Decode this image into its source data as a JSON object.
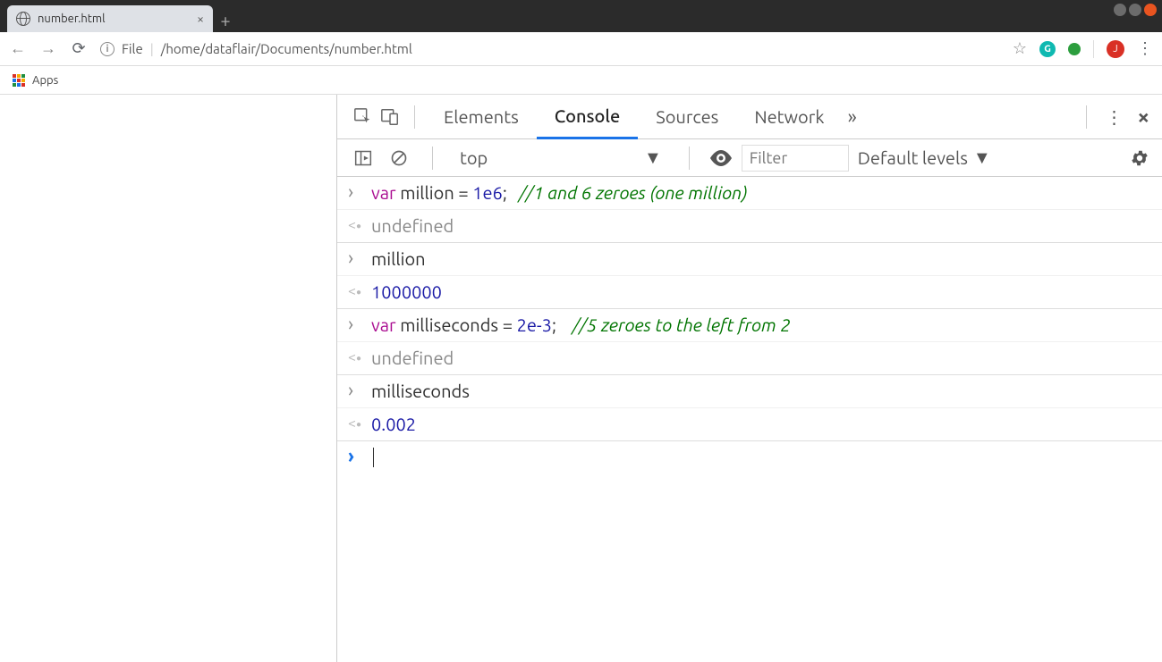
{
  "tab": {
    "title": "number.html"
  },
  "addressbar": {
    "file_label": "File",
    "path": "/home/dataflair/Documents/number.html"
  },
  "bookmarks": {
    "apps": "Apps"
  },
  "extensions": {
    "grammarly_letter": "G",
    "avatar_letter": "J"
  },
  "devtools": {
    "tabs": {
      "elements": "Elements",
      "console": "Console",
      "sources": "Sources",
      "network": "Network"
    },
    "toolbar": {
      "context": "top",
      "filter_placeholder": "Filter",
      "levels": "Default levels"
    },
    "console_entries": [
      {
        "type": "input",
        "tokens": [
          {
            "t": "kw",
            "v": "var"
          },
          {
            "t": "txt",
            "v": " million = "
          },
          {
            "t": "num",
            "v": "1e6"
          },
          {
            "t": "txt",
            "v": ";   "
          },
          {
            "t": "cmt",
            "v": "//1 and 6 zeroes (one million)"
          }
        ]
      },
      {
        "type": "output",
        "tokens": [
          {
            "t": "undef",
            "v": "undefined"
          }
        ],
        "group_end": true
      },
      {
        "type": "input",
        "tokens": [
          {
            "t": "txt",
            "v": "million"
          }
        ]
      },
      {
        "type": "output",
        "tokens": [
          {
            "t": "num",
            "v": "1000000"
          }
        ],
        "group_end": true
      },
      {
        "type": "input",
        "tokens": [
          {
            "t": "kw",
            "v": "var"
          },
          {
            "t": "txt",
            "v": " milliseconds = "
          },
          {
            "t": "num",
            "v": "2e-3"
          },
          {
            "t": "txt",
            "v": ";    "
          },
          {
            "t": "cmt",
            "v": "//5 zeroes to the left from 2"
          }
        ]
      },
      {
        "type": "output",
        "tokens": [
          {
            "t": "undef",
            "v": "undefined"
          }
        ],
        "group_end": true
      },
      {
        "type": "input",
        "tokens": [
          {
            "t": "txt",
            "v": "milliseconds"
          }
        ]
      },
      {
        "type": "output",
        "tokens": [
          {
            "t": "num",
            "v": "0.002"
          }
        ],
        "group_end": true
      }
    ]
  }
}
